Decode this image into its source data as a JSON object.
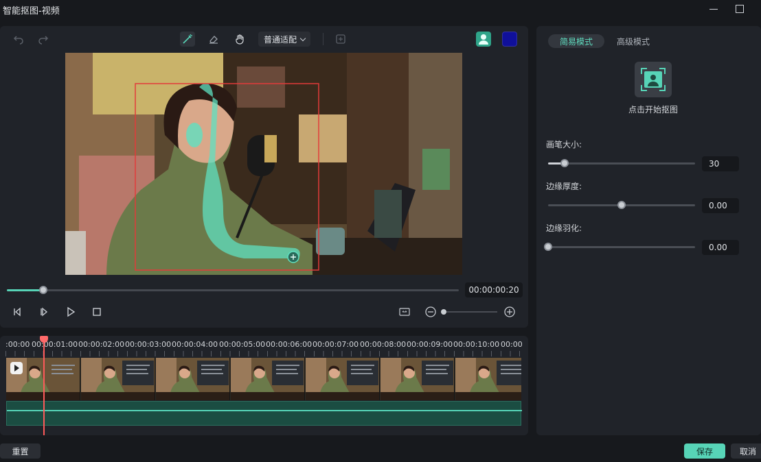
{
  "window": {
    "title": "智能抠图-视频"
  },
  "toolbar": {
    "mode_select": "普通适配",
    "person_button_color": "#2fa58a",
    "mask_color": "#10109a"
  },
  "player": {
    "timecode": "00:00:00:20",
    "progress": 0.08,
    "zoom_level": 0.03
  },
  "timeline": {
    "ruler_labels": [
      ":00:00",
      "00:00:01:00",
      "00:00:02:00",
      "00:00:03:00",
      "00:00:04:00",
      "00:00:05:00",
      "00:00:06:00",
      "00:00:07:00",
      "00:00:08:00",
      "00:00:09:00",
      "00:00:10:00",
      "00:00"
    ]
  },
  "panel": {
    "tabs": [
      "简易模式",
      "高级模式"
    ],
    "start_label": "点击开始抠图",
    "params": [
      {
        "label": "画笔大小:",
        "value": "30",
        "level": 0.11
      },
      {
        "label": "边缘厚度:",
        "value": "0.00",
        "level": 0.5
      },
      {
        "label": "边缘羽化:",
        "value": "0.00",
        "level": 0.0
      }
    ]
  },
  "footer": {
    "reset": "重置",
    "save": "保存",
    "cancel": "取消"
  },
  "accent_color": "#57d4b7",
  "selection_color": "#e23a3a"
}
